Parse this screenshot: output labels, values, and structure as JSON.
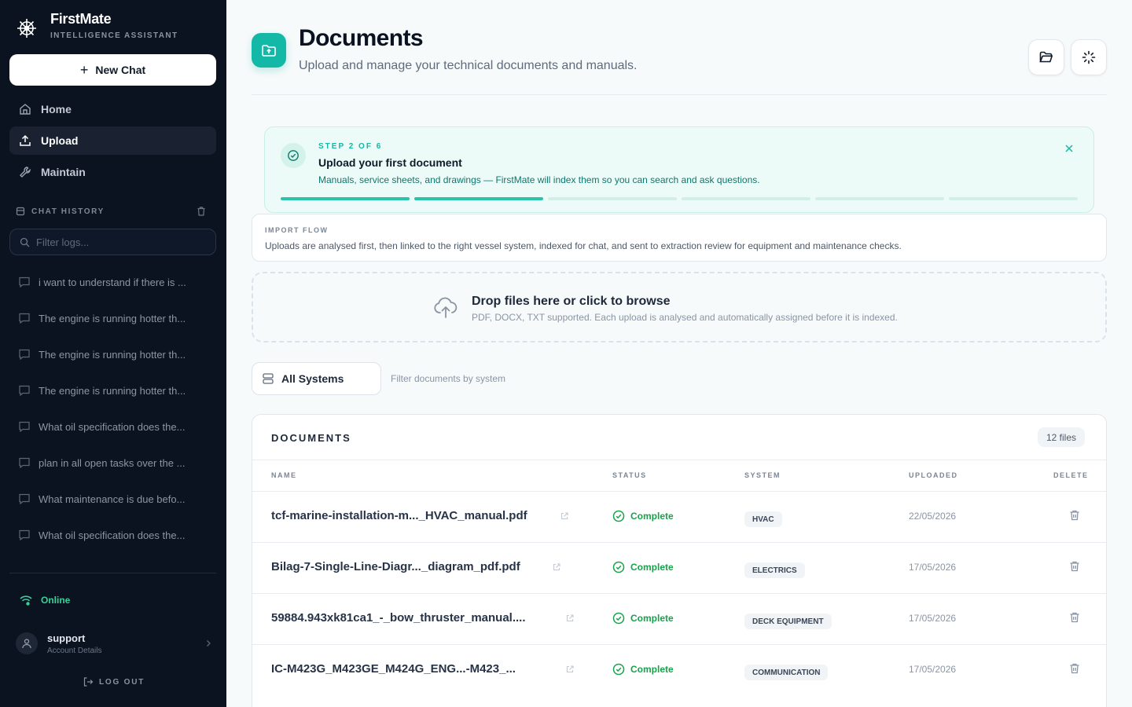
{
  "brand": {
    "name": "FirstMate",
    "tagline": "INTELLIGENCE ASSISTANT"
  },
  "sidebar": {
    "new_chat": "New Chat",
    "nav": [
      {
        "label": "Home",
        "icon": "home-icon",
        "active": false
      },
      {
        "label": "Upload",
        "icon": "upload-icon",
        "active": true
      },
      {
        "label": "Maintain",
        "icon": "wrench-icon",
        "active": false
      }
    ],
    "history_label": "CHAT HISTORY",
    "filter_placeholder": "Filter logs...",
    "history": [
      "i want to understand if there is ...",
      "The engine is running hotter th...",
      "The engine is running hotter th...",
      "The engine is running hotter th...",
      "What oil specification does the...",
      "plan in all open tasks over the ...",
      "What maintenance is due befo...",
      "What oil specification does the..."
    ],
    "status": "Online",
    "account": {
      "user": "support",
      "detail": "Account Details"
    },
    "logout": "LOG OUT"
  },
  "header": {
    "title": "Documents",
    "subtitle": "Upload and manage your technical documents and manuals."
  },
  "step": {
    "label": "STEP 2 OF 6",
    "title": "Upload your first document",
    "description": "Manuals, service sheets, and drawings — FirstMate will index them so you can search and ask questions.",
    "total": 6,
    "completed": 2
  },
  "import_flow": {
    "label": "IMPORT FLOW",
    "description": "Uploads are analysed first, then linked to the right vessel system, indexed for chat, and sent to extraction review for equipment and maintenance checks."
  },
  "dropzone": {
    "title": "Drop files here or click to browse",
    "subtitle": "PDF, DOCX, TXT supported. Each upload is analysed and automatically assigned before it is indexed."
  },
  "system_filter": {
    "selected": "All Systems",
    "hint": "Filter documents by system"
  },
  "documents": {
    "heading": "DOCUMENTS",
    "count": "12 files",
    "columns": {
      "name": "NAME",
      "status": "STATUS",
      "system": "SYSTEM",
      "uploaded": "UPLOADED",
      "delete": "DELETE"
    },
    "rows": [
      {
        "name": "tcf-marine-installation-m..._HVAC_manual.pdf",
        "status": "Complete",
        "system": "HVAC",
        "uploaded": "22/05/2026"
      },
      {
        "name": "Bilag-7-Single-Line-Diagr..._diagram_pdf.pdf",
        "status": "Complete",
        "system": "ELECTRICS",
        "uploaded": "17/05/2026"
      },
      {
        "name": "59884.943xk81ca1_-_bow_thruster_manual....",
        "status": "Complete",
        "system": "DECK EQUIPMENT",
        "uploaded": "17/05/2026"
      },
      {
        "name": "IC-M423G_M423GE_M424G_ENG...-M423_...",
        "status": "Complete",
        "system": "COMMUNICATION",
        "uploaded": "17/05/2026"
      }
    ]
  },
  "colors": {
    "accent": "#14b8a6",
    "sidebar_bg": "#0b1321",
    "status_ok": "#16a34a"
  }
}
